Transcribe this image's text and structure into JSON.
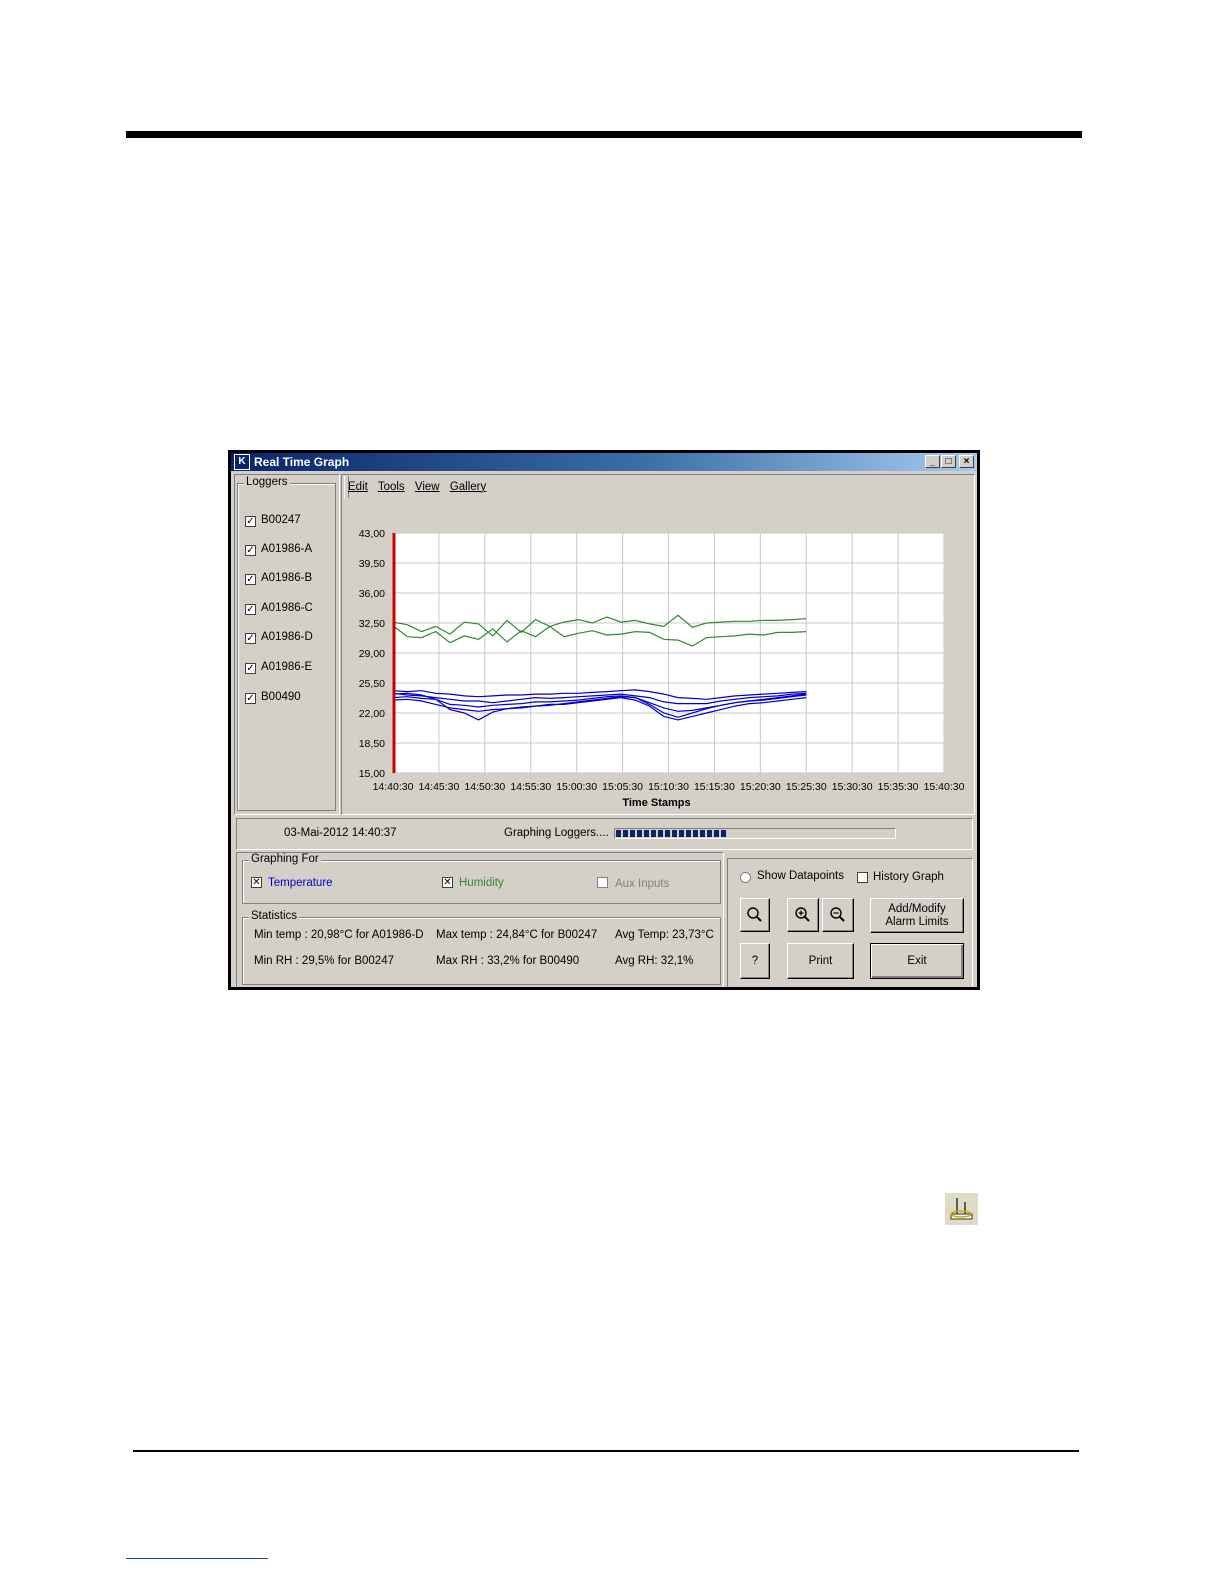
{
  "window": {
    "title": "Real Time Graph",
    "controls": {
      "minimize": "_",
      "maximize": "□",
      "close": "×"
    }
  },
  "loggers": {
    "group_label": "Loggers",
    "items": [
      {
        "label": "B00247",
        "checked": true
      },
      {
        "label": "A01986-A",
        "checked": true
      },
      {
        "label": "A01986-B",
        "checked": true
      },
      {
        "label": "A01986-C",
        "checked": true
      },
      {
        "label": "A01986-D",
        "checked": true
      },
      {
        "label": "A01986-E",
        "checked": true
      },
      {
        "label": "B00490",
        "checked": true
      }
    ]
  },
  "menu": {
    "edit": "Edit",
    "tools": "Tools",
    "view": "View",
    "gallery": "Gallery"
  },
  "chart_data": {
    "type": "line",
    "xlabel": "Time Stamps",
    "x_ticks": [
      "14:40:30",
      "14:45:30",
      "14:50:30",
      "14:55:30",
      "15:00:30",
      "15:05:30",
      "15:10:30",
      "15:15:30",
      "15:20:30",
      "15:25:30",
      "15:30:30",
      "15:35:30",
      "15:40:30"
    ],
    "y_ticks": [
      "15,00",
      "18,50",
      "22,00",
      "25,50",
      "29,00",
      "32,50",
      "36,00",
      "39,50",
      "43,00"
    ],
    "ylim": [
      15,
      43
    ],
    "grid": true,
    "cursor_x": "14:40:30",
    "colors": {
      "temperature": "#0000cc",
      "humidity": "#2e8b2e",
      "cursor": "#cc0000"
    },
    "humidity_series": [
      {
        "values": [
          32.6,
          32.3,
          31.5,
          32.1,
          31.2,
          32.6,
          32.4,
          31.0,
          32.8,
          31.4,
          32.9,
          32.1,
          32.6,
          32.9,
          32.5,
          33.2,
          32.6,
          32.8,
          32.4,
          32.1,
          33.4,
          32.0,
          32.5,
          32.6,
          32.7,
          32.7,
          32.8,
          32.8,
          32.9,
          33.0
        ]
      },
      {
        "values": [
          32.2,
          30.9,
          30.8,
          31.5,
          30.2,
          31.0,
          30.6,
          31.8,
          30.3,
          31.6,
          30.9,
          32.1,
          30.9,
          31.3,
          31.6,
          31.1,
          31.2,
          31.5,
          31.4,
          30.6,
          30.5,
          29.8,
          30.8,
          30.9,
          31.0,
          31.2,
          31.1,
          31.4,
          31.4,
          31.5
        ]
      }
    ],
    "temperature_series": [
      {
        "values": [
          24.3,
          24.1,
          24.0,
          23.8,
          23.6,
          23.4,
          23.4,
          23.2,
          23.4,
          23.6,
          23.8,
          23.7,
          23.8,
          23.9,
          24.0,
          24.1,
          24.2,
          24.0,
          23.8,
          23.3,
          23.1,
          23.1,
          23.1,
          23.4,
          23.6,
          23.8,
          23.9,
          24.0,
          24.2,
          24.3
        ]
      },
      {
        "values": [
          24.6,
          24.5,
          24.6,
          24.3,
          24.2,
          24.0,
          23.9,
          24.0,
          24.1,
          24.1,
          24.2,
          24.2,
          24.3,
          24.3,
          24.4,
          24.5,
          24.6,
          24.7,
          24.5,
          24.2,
          23.8,
          23.7,
          23.6,
          23.8,
          24.0,
          24.1,
          24.2,
          24.3,
          24.4,
          24.5
        ]
      },
      {
        "values": [
          23.8,
          23.9,
          23.7,
          23.6,
          23.0,
          22.9,
          22.7,
          22.9,
          23.0,
          23.1,
          23.3,
          23.3,
          23.4,
          23.5,
          23.7,
          23.9,
          24.0,
          23.8,
          23.2,
          22.6,
          22.2,
          22.3,
          22.6,
          22.9,
          23.2,
          23.4,
          23.5,
          23.7,
          23.9,
          24.1
        ]
      },
      {
        "values": [
          23.5,
          23.6,
          23.4,
          23.0,
          22.6,
          22.4,
          22.2,
          22.4,
          22.5,
          22.6,
          22.8,
          23.0,
          23.0,
          23.2,
          23.4,
          23.6,
          23.8,
          23.5,
          22.8,
          21.6,
          21.2,
          21.6,
          22.0,
          22.4,
          22.8,
          23.1,
          23.2,
          23.4,
          23.6,
          23.8
        ]
      },
      {
        "values": [
          24.2,
          24.3,
          24.1,
          23.6,
          22.4,
          22.0,
          21.2,
          22.1,
          22.5,
          22.7,
          22.8,
          22.9,
          23.1,
          23.3,
          23.5,
          23.7,
          23.9,
          23.8,
          23.0,
          22.0,
          21.5,
          22.0,
          22.5,
          22.9,
          23.2,
          23.4,
          23.6,
          23.8,
          24.0,
          24.2
        ]
      }
    ]
  },
  "status": {
    "timestamp": "03-Mai-2012 14:40:37",
    "graphing_label": "Graphing Loggers....",
    "progress": 0.4
  },
  "graphing_for": {
    "group_label": "Graphing For",
    "temperature": {
      "label": "Temperature",
      "checked": true
    },
    "humidity": {
      "label": "Humidity",
      "checked": true
    },
    "aux": {
      "label": "Aux Inputs",
      "checked": false
    }
  },
  "statistics": {
    "group_label": "Statistics",
    "min_temp": "Min temp : 20,98°C for A01986-D",
    "max_temp": "Max temp : 24,84°C for B00247",
    "avg_temp": "Avg Temp: 23,73°C",
    "min_rh": "Min RH : 29,5% for B00247",
    "max_rh": "Max RH : 33,2% for B00490",
    "avg_rh": "Avg RH: 32,1%"
  },
  "options": {
    "show_datapoints": "Show Datapoints",
    "history_graph": "History Graph"
  },
  "buttons": {
    "add_modify_line1": "Add/Modify",
    "add_modify_line2": "Alarm Limits",
    "help": "?",
    "print": "Print",
    "exit": "Exit"
  }
}
